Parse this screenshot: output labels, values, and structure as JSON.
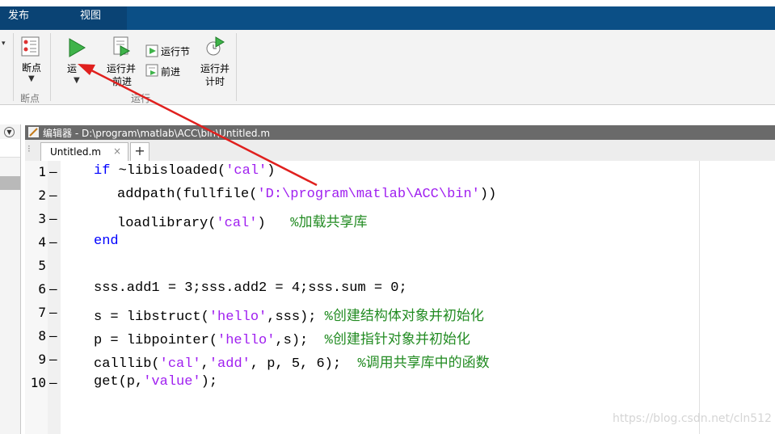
{
  "top_tabs": {
    "publish": "发布",
    "view": "视图"
  },
  "ribbon": {
    "breakpoints_label": "断点",
    "breakpoints_group": "断点",
    "run_label": "运",
    "run_advance_line1": "运行并",
    "run_advance_line2": "前进",
    "run_section": "运行节",
    "advance": "前进",
    "run_time_line1": "运行并",
    "run_time_line2": "计时",
    "run_group": "运行"
  },
  "editor": {
    "title": "编辑器 - D:\\program\\matlab\\ACC\\bin\\Untitled.m",
    "tab_label": "Untitled.m",
    "close_glyph": "×",
    "add_glyph": "+"
  },
  "code_lines": [
    {
      "num": "1",
      "dash": "—",
      "segments": [
        [
          "kw",
          "if"
        ],
        [
          "p",
          " ~libisloaded("
        ],
        [
          "str",
          "'cal'"
        ],
        [
          "p",
          ")"
        ]
      ],
      "indent": 0
    },
    {
      "num": "2",
      "dash": "—",
      "segments": [
        [
          "p",
          "addpath(fullfile("
        ],
        [
          "str",
          "'D:\\program\\matlab\\ACC\\bin'"
        ],
        [
          "p",
          "))"
        ]
      ],
      "indent": 1
    },
    {
      "num": "3",
      "dash": "—",
      "segments": [
        [
          "p",
          "loadlibrary("
        ],
        [
          "str",
          "'cal'"
        ],
        [
          "p",
          ")   "
        ],
        [
          "cmt",
          "%加载共享库"
        ]
      ],
      "indent": 1
    },
    {
      "num": "4",
      "dash": "—",
      "segments": [
        [
          "kw",
          "end"
        ]
      ],
      "indent": 0
    },
    {
      "num": "5",
      "dash": "",
      "segments": [],
      "indent": 0
    },
    {
      "num": "6",
      "dash": "—",
      "segments": [
        [
          "p",
          "sss.add1 = 3;sss.add2 = 4;sss.sum = 0;"
        ]
      ],
      "indent": 0
    },
    {
      "num": "7",
      "dash": "—",
      "segments": [
        [
          "p",
          "s = libstruct("
        ],
        [
          "str",
          "'hello'"
        ],
        [
          "p",
          ",sss); "
        ],
        [
          "cmt",
          "%创建结构体对象并初始化"
        ]
      ],
      "indent": 0
    },
    {
      "num": "8",
      "dash": "—",
      "segments": [
        [
          "p",
          "p = libpointer("
        ],
        [
          "str",
          "'hello'"
        ],
        [
          "p",
          ",s);  "
        ],
        [
          "cmt",
          "%创建指针对象并初始化"
        ]
      ],
      "indent": 0
    },
    {
      "num": "9",
      "dash": "—",
      "segments": [
        [
          "p",
          "calllib("
        ],
        [
          "str",
          "'cal'"
        ],
        [
          "p",
          ","
        ],
        [
          "str",
          "'add'"
        ],
        [
          "p",
          ", p, 5, 6);  "
        ],
        [
          "cmt",
          "%调用共享库中的函数"
        ]
      ],
      "indent": 0
    },
    {
      "num": "10",
      "dash": "—",
      "segments": [
        [
          "p",
          "get(p,"
        ],
        [
          "str",
          "'value'"
        ],
        [
          "p",
          ");"
        ]
      ],
      "indent": 0
    }
  ],
  "watermark": "https://blog.csdn.net/cln512",
  "colors": {
    "keyword": "#0000ff",
    "string": "#a020f0",
    "comment": "#228b22",
    "tabbar": "#0b4f86",
    "arrow": "#e0201e"
  }
}
